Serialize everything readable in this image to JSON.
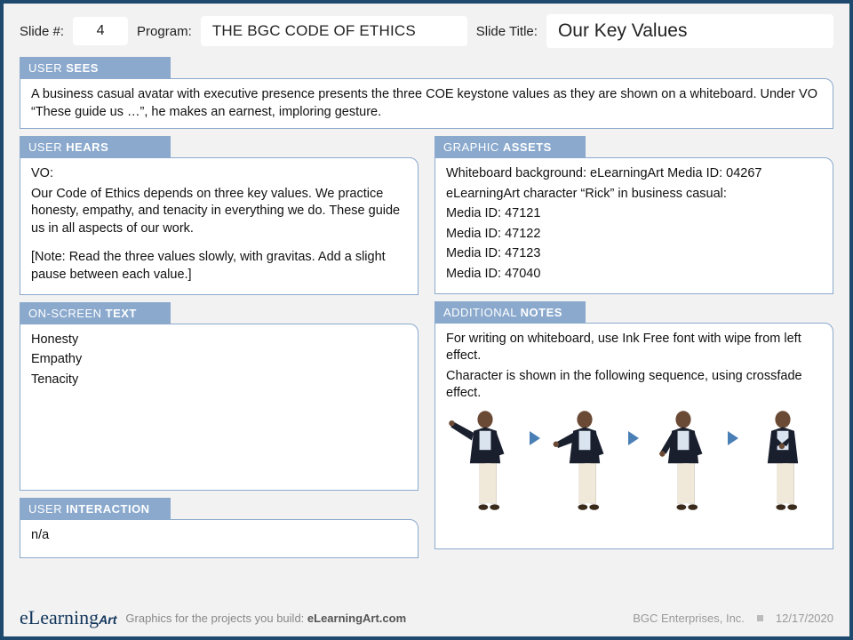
{
  "header": {
    "slide_num_label": "Slide #:",
    "slide_num": "4",
    "program_label": "Program:",
    "program": "THE BGC CODE OF ETHICS",
    "title_label": "Slide Title:",
    "title": "Our Key Values"
  },
  "user_sees": {
    "label_a": "USER ",
    "label_b": "SEES",
    "body": "A business casual avatar with executive presence presents the three COE keystone values as they are shown on a whiteboard. Under VO “These guide us …”, he makes an earnest, imploring gesture."
  },
  "user_hears": {
    "label_a": "USER ",
    "label_b": "HEARS",
    "vo_label": "VO:",
    "vo_body": "Our Code of Ethics depends on three key values. We practice honesty, empathy, and tenacity in everything we do. These guide us in all aspects of our work.",
    "note": "[Note: Read the three values slowly, with gravitas. Add a slight pause between each value.]"
  },
  "graphic_assets": {
    "label_a": "GRAPHIC ",
    "label_b": "ASSETS",
    "lines": [
      "Whiteboard background: eLearningArt Media ID: 04267",
      "eLearningArt character “Rick” in business casual:",
      "Media ID: 47121",
      "Media ID: 47122",
      "Media ID: 47123",
      "Media ID: 47040"
    ]
  },
  "onscreen_text": {
    "label_a": "ON-SCREEN ",
    "label_b": "TEXT",
    "lines": [
      "Honesty",
      "Empathy",
      "Tenacity"
    ]
  },
  "additional_notes": {
    "label_a": "ADDITIONAL  ",
    "label_b": "NOTES",
    "line1": "For writing on whiteboard, use Ink Free font with wipe from left effect.",
    "line2": "Character is shown in the following sequence, using crossfade effect."
  },
  "user_interaction": {
    "label_a": "USER ",
    "label_b": "INTERACTION",
    "body": "n/a"
  },
  "footer": {
    "logo_a": "eLearning",
    "logo_b": "Art",
    "tag_a": "Graphics for the projects you build: ",
    "tag_b": "eLearningArt.com",
    "company": "BGC Enterprises, Inc.",
    "date": "12/17/2020"
  }
}
